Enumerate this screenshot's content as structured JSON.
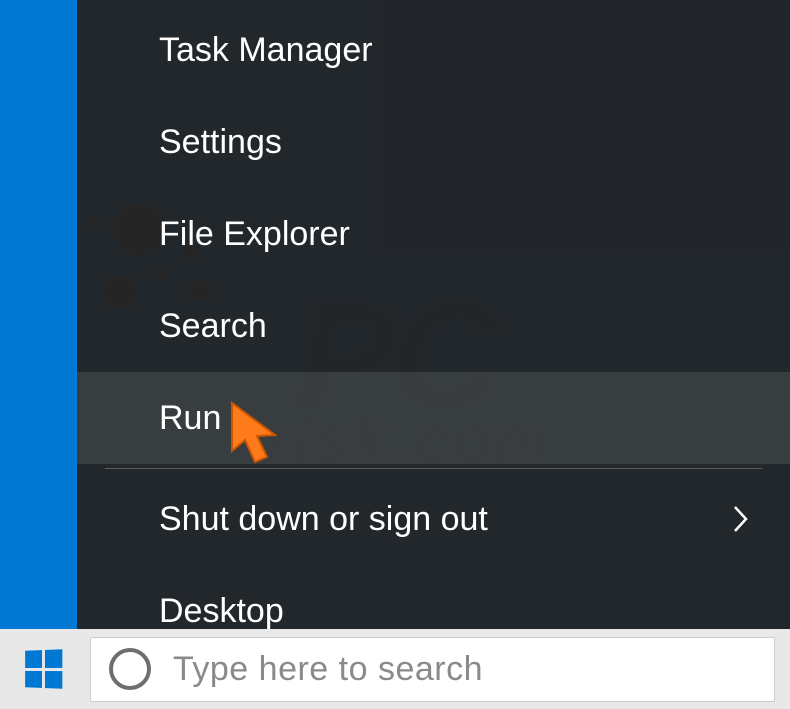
{
  "context_menu": {
    "items": [
      {
        "label": "Task Manager",
        "highlighted": false,
        "has_submenu": false
      },
      {
        "label": "Settings",
        "highlighted": false,
        "has_submenu": false
      },
      {
        "label": "File Explorer",
        "highlighted": false,
        "has_submenu": false
      },
      {
        "label": "Search",
        "highlighted": false,
        "has_submenu": false
      },
      {
        "label": "Run",
        "highlighted": true,
        "has_submenu": false
      },
      {
        "label": "Shut down or sign out",
        "highlighted": false,
        "has_submenu": true
      },
      {
        "label": "Desktop",
        "highlighted": false,
        "has_submenu": false
      }
    ],
    "divider_after_index": 4
  },
  "taskbar": {
    "search_placeholder": "Type here to search"
  },
  "watermark": {
    "main": "PC",
    "sub": "risk.com"
  }
}
